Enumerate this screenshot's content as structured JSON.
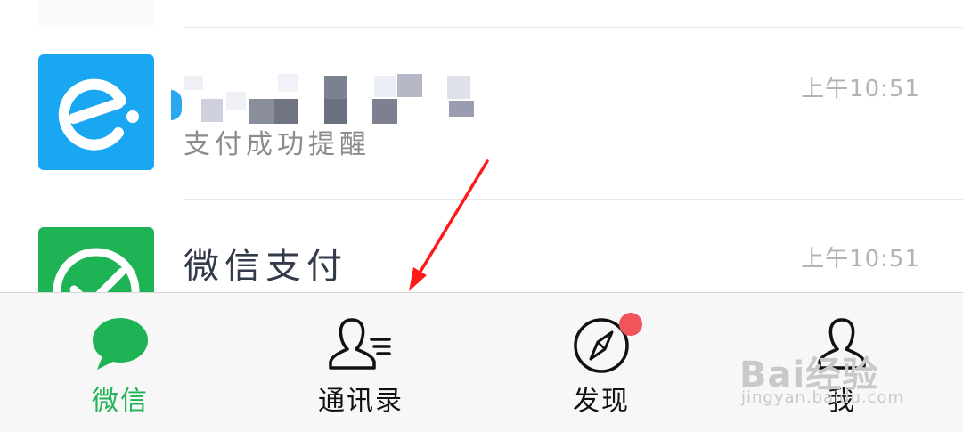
{
  "chats": [
    {
      "avatar": "eleme-icon",
      "avatar_color": "#1aa7f1",
      "title_obscured": true,
      "preview": "支付成功提醒",
      "time": "上午10:51"
    },
    {
      "avatar": "wechat-pay-check-icon",
      "avatar_color": "#1eb354",
      "title": "微信支付",
      "time": "上午10:51"
    }
  ],
  "tabbar": {
    "tabs": [
      {
        "label": "微信",
        "icon": "chat-bubble-icon",
        "active": true
      },
      {
        "label": "通讯录",
        "icon": "contacts-icon",
        "active": false
      },
      {
        "label": "发现",
        "icon": "compass-icon",
        "active": false,
        "badge": true
      },
      {
        "label": "我",
        "icon": "person-icon",
        "active": false
      }
    ]
  },
  "colors": {
    "accent": "#1eb354",
    "badge": "#f2545b",
    "annotation_arrow": "#ff1a1a"
  },
  "watermark": {
    "brand": "Bai经验",
    "url": "jingyan.baidu.com"
  }
}
